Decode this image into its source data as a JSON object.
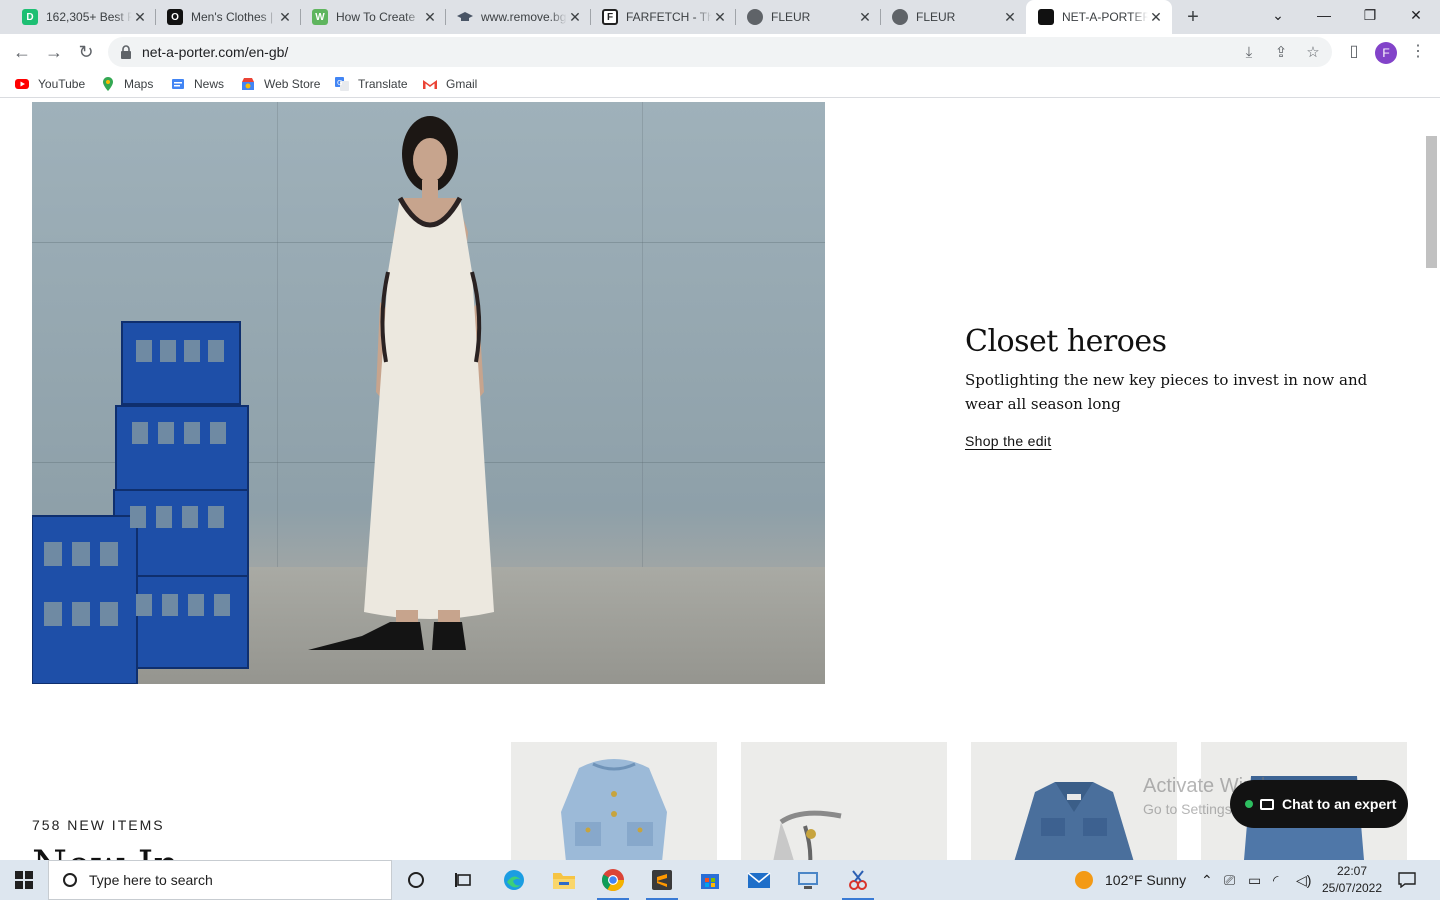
{
  "browser": {
    "tabs": [
      {
        "title": "162,305+ Best F",
        "favicon_color": "#1dbf73",
        "favicon_letter": "D"
      },
      {
        "title": "Men's Clothes | ",
        "favicon_color": "#111111",
        "favicon_letter": "O"
      },
      {
        "title": "How To Create ",
        "favicon_color": "#5fb55e",
        "favicon_letter": "W"
      },
      {
        "title": "www.remove.bg",
        "favicon_color": "#4a5566",
        "favicon_letter": ""
      },
      {
        "title": "FARFETCH - The",
        "favicon_color": "#222222",
        "favicon_letter": "F"
      },
      {
        "title": "FLEUR",
        "favicon_color": "#5f6368",
        "favicon_letter": ""
      },
      {
        "title": "FLEUR",
        "favicon_color": "#5f6368",
        "favicon_letter": ""
      },
      {
        "title": "NET-A-PORTER",
        "favicon_color": "#111111",
        "favicon_letter": ""
      }
    ],
    "active_tab_index": 7,
    "url": "net-a-porter.com/en-gb/",
    "profile_initial": "F",
    "bookmarks": [
      {
        "label": "YouTube",
        "color": "#ff0000"
      },
      {
        "label": "Maps",
        "color": "#34a853"
      },
      {
        "label": "News",
        "color": "#4285f4"
      },
      {
        "label": "Web Store",
        "color": "#ea4335"
      },
      {
        "label": "Translate",
        "color": "#4285f4"
      },
      {
        "label": "Gmail",
        "color": "#ea4335"
      }
    ]
  },
  "page": {
    "promo": {
      "title": "Closet heroes",
      "description": "Spotlighting the new key pieces to invest in now and wear all season long",
      "link": "Shop the edit"
    },
    "new_in": {
      "count_label": "758 NEW ITEMS",
      "heading": "New In"
    },
    "chat_button": "Chat to an expert",
    "watermark": {
      "title": "Activate Windows",
      "subtitle": "Go to Settings to activate Windows."
    }
  },
  "taskbar": {
    "search_placeholder": "Type here to search",
    "weather": "102°F  Sunny",
    "time": "22:07",
    "date": "25/07/2022"
  }
}
